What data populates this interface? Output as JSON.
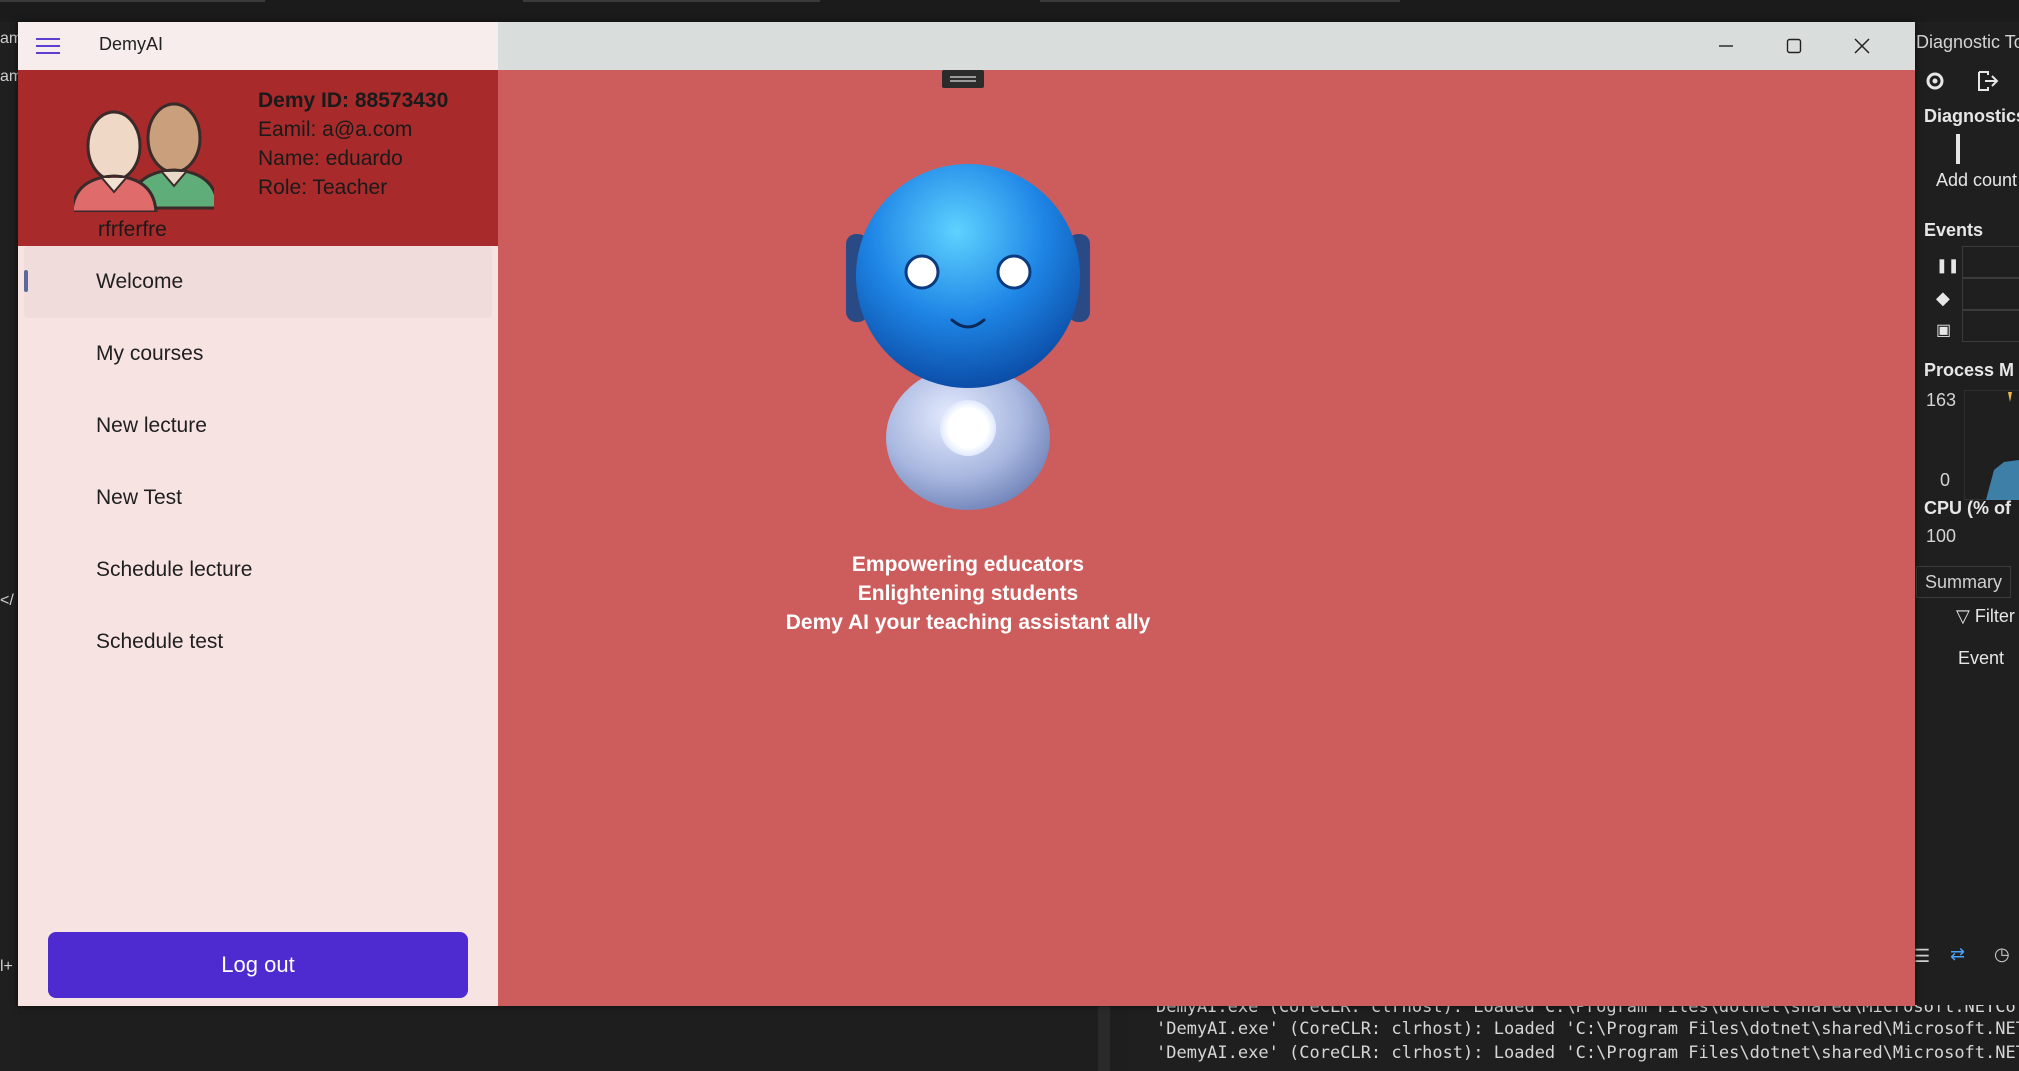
{
  "window": {
    "title": "DemyAI"
  },
  "profile": {
    "demy_id": "Demy ID: 88573430",
    "email": "Eamil: a@a.com",
    "name": "Name: eduardo",
    "role": "Role: Teacher",
    "username": "rfrferfre"
  },
  "menu": {
    "items": [
      {
        "label": "Welcome",
        "active": true
      },
      {
        "label": "My courses"
      },
      {
        "label": "New lecture"
      },
      {
        "label": "New Test"
      },
      {
        "label": "Schedule lecture"
      },
      {
        "label": "Schedule test"
      }
    ],
    "logout_label": "Log out"
  },
  "content": {
    "tagline": [
      "Empowering educators",
      "Enlightening students",
      "Demy AI your teaching assistant ally"
    ],
    "robot_icon": "robot-mascot-icon"
  },
  "colors": {
    "content_bg": "#cd5c5c",
    "profile_bg": "#a82a2a",
    "drawer_bg": "#f8e3e3",
    "logout_bg": "#4e2ad1"
  },
  "ide": {
    "left_fragments": [
      "am",
      "am",
      "</",
      "l+"
    ],
    "diagnostic_title": "Diagnostic To",
    "diagnostics": "Diagnostics",
    "add_counter": "Add count",
    "events": "Events",
    "process_memory": "Process M",
    "mem_max": "163",
    "mem_min": "0",
    "cpu": "CPU (% of",
    "cpu_max": "100",
    "summary_tab": "Summary",
    "filter": "Filter",
    "event_col": "Event",
    "output_lines": [
      " DemyAI.exe  (CoreCLR: clrhost): Loaded  C:\\Program Files\\dotnet\\shared\\Microsoft.NETCo",
      "'DemyAI.exe' (CoreCLR: clrhost): Loaded 'C:\\Program Files\\dotnet\\shared\\Microsoft.NETCo",
      "'DemyAI.exe' (CoreCLR: clrhost): Loaded 'C:\\Program Files\\dotnet\\shared\\Microsoft.NETCo"
    ]
  }
}
